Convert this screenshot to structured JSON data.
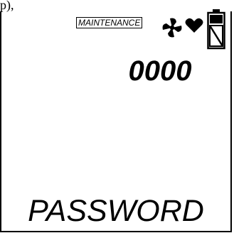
{
  "corner_fragment": "p),",
  "status_bar": {
    "mode_label": "MAINTENANCE",
    "icons": [
      "fan-icon",
      "heart-icon",
      "battery-icon"
    ]
  },
  "main": {
    "code_value": "0000",
    "prompt_label": "PASSWORD"
  }
}
